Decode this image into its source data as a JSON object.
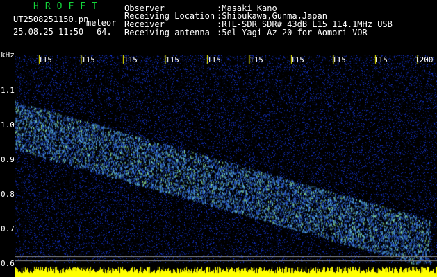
{
  "header": {
    "brand": "HROFFT",
    "filename": "UT2508251150.pn",
    "tag": "meteor",
    "datetime": "25.08.25 11:50",
    "value": "64.",
    "labels": [
      "Observer",
      "Receiving Location",
      "Receiver",
      "Receiving antenna"
    ],
    "values": [
      ":Masaki Kano",
      ":Shibukawa,Gunma,Japan",
      ":RTL-SDR SDR# 43dB L15 114.1MHz USB",
      ":5el Yagi Az 20 for Aomori VOR"
    ]
  },
  "axes": {
    "y_unit": "kHz",
    "y_ticks": [
      "1.1",
      "1.0",
      "0.9",
      "0.8",
      "0.7",
      "0.6"
    ],
    "x_ticks": [
      "115",
      "115",
      "115",
      "115",
      "115",
      "115",
      "115",
      "115",
      "115",
      "1200"
    ]
  },
  "colors": {
    "background": "#000000",
    "text": "#ffffff",
    "brand": "#13d63a",
    "tick": "#ffff00",
    "noise": "#0b1f9c",
    "signal": "#59b0e0",
    "baseline": "#ffff00"
  }
}
